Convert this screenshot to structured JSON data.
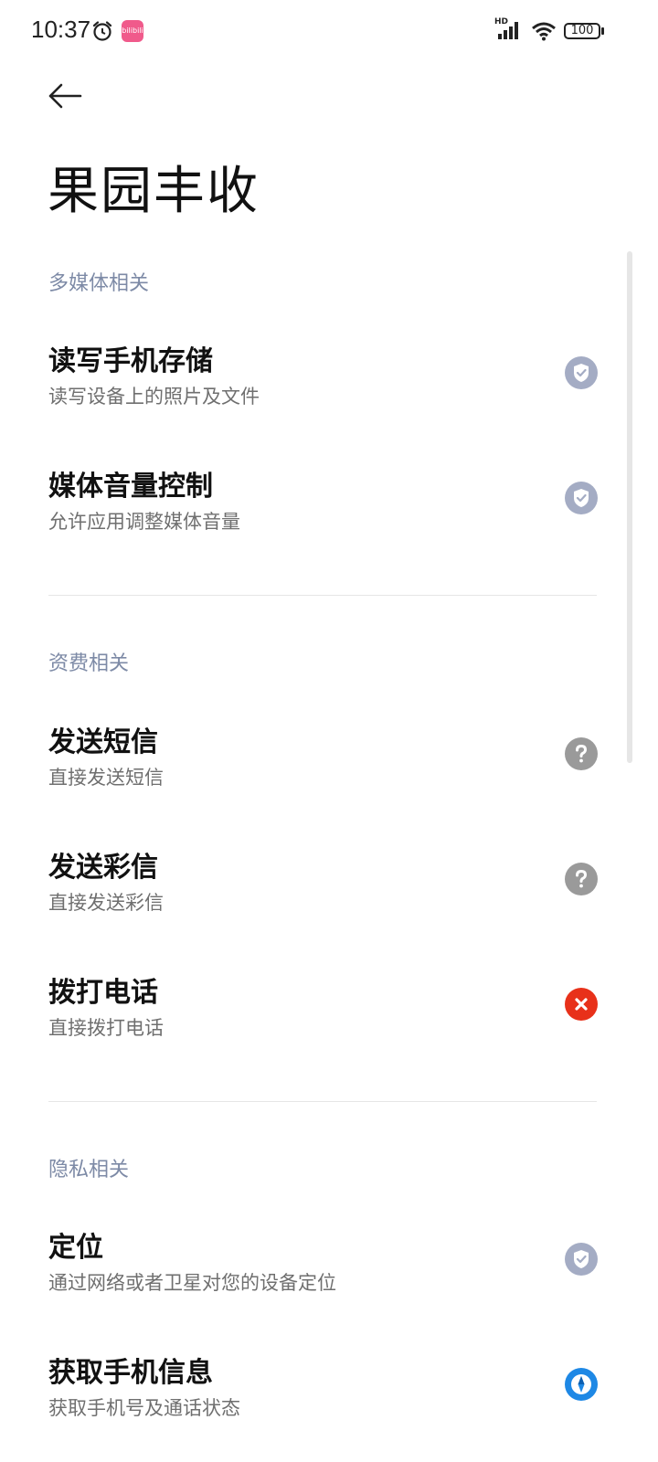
{
  "status_bar": {
    "time": "10:37",
    "app_badge_label": "bilibili",
    "hd_label": "HD",
    "battery": "100"
  },
  "header": {
    "title": "果园丰收"
  },
  "sections": [
    {
      "label": "多媒体相关",
      "items": [
        {
          "title": "读写手机存储",
          "desc": "读写设备上的照片及文件",
          "status": "allowed"
        },
        {
          "title": "媒体音量控制",
          "desc": "允许应用调整媒体音量",
          "status": "allowed"
        }
      ]
    },
    {
      "label": "资费相关",
      "items": [
        {
          "title": "发送短信",
          "desc": "直接发送短信",
          "status": "ask"
        },
        {
          "title": "发送彩信",
          "desc": "直接发送彩信",
          "status": "ask"
        },
        {
          "title": "拨打电话",
          "desc": "直接拨打电话",
          "status": "denied"
        }
      ]
    },
    {
      "label": "隐私相关",
      "items": [
        {
          "title": "定位",
          "desc": "通过网络或者卫星对您的设备定位",
          "status": "allowed"
        },
        {
          "title": "获取手机信息",
          "desc": "获取手机号及通话状态",
          "status": "while-in-use"
        }
      ]
    }
  ],
  "colors": {
    "allowed": "#a4acc4",
    "ask": "#9a9a9a",
    "denied": "#e8311a",
    "while-in-use": "#1e88e5",
    "section_header": "#7d8aa6"
  },
  "icons": {
    "allowed": "shield-check-icon",
    "ask": "question-icon",
    "denied": "close-circle-icon",
    "while-in-use": "compass-icon"
  }
}
